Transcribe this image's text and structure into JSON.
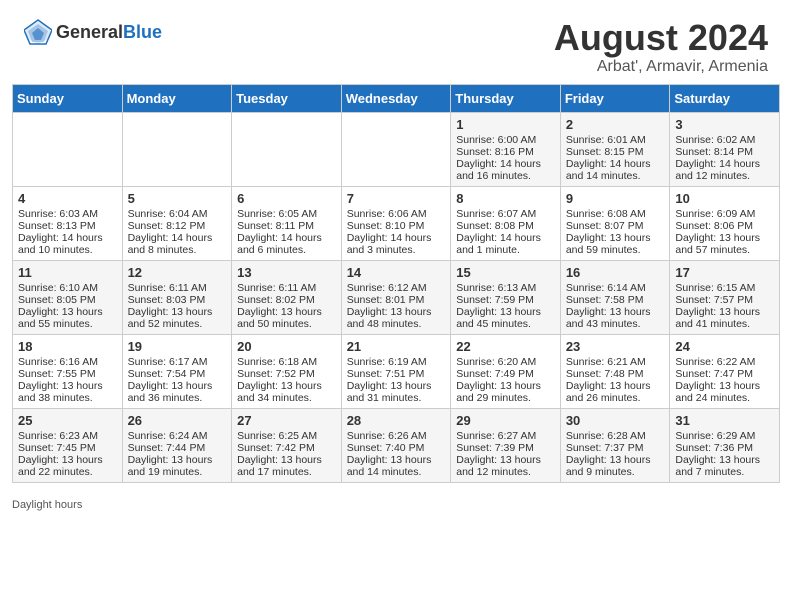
{
  "header": {
    "logo_general": "General",
    "logo_blue": "Blue",
    "title": "August 2024",
    "subtitle": "Arbat', Armavir, Armenia"
  },
  "days_of_week": [
    "Sunday",
    "Monday",
    "Tuesday",
    "Wednesday",
    "Thursday",
    "Friday",
    "Saturday"
  ],
  "weeks": [
    [
      {
        "day": "",
        "info": ""
      },
      {
        "day": "",
        "info": ""
      },
      {
        "day": "",
        "info": ""
      },
      {
        "day": "",
        "info": ""
      },
      {
        "day": "1",
        "info": "Sunrise: 6:00 AM\nSunset: 8:16 PM\nDaylight: 14 hours and 16 minutes."
      },
      {
        "day": "2",
        "info": "Sunrise: 6:01 AM\nSunset: 8:15 PM\nDaylight: 14 hours and 14 minutes."
      },
      {
        "day": "3",
        "info": "Sunrise: 6:02 AM\nSunset: 8:14 PM\nDaylight: 14 hours and 12 minutes."
      }
    ],
    [
      {
        "day": "4",
        "info": "Sunrise: 6:03 AM\nSunset: 8:13 PM\nDaylight: 14 hours and 10 minutes."
      },
      {
        "day": "5",
        "info": "Sunrise: 6:04 AM\nSunset: 8:12 PM\nDaylight: 14 hours and 8 minutes."
      },
      {
        "day": "6",
        "info": "Sunrise: 6:05 AM\nSunset: 8:11 PM\nDaylight: 14 hours and 6 minutes."
      },
      {
        "day": "7",
        "info": "Sunrise: 6:06 AM\nSunset: 8:10 PM\nDaylight: 14 hours and 3 minutes."
      },
      {
        "day": "8",
        "info": "Sunrise: 6:07 AM\nSunset: 8:08 PM\nDaylight: 14 hours and 1 minute."
      },
      {
        "day": "9",
        "info": "Sunrise: 6:08 AM\nSunset: 8:07 PM\nDaylight: 13 hours and 59 minutes."
      },
      {
        "day": "10",
        "info": "Sunrise: 6:09 AM\nSunset: 8:06 PM\nDaylight: 13 hours and 57 minutes."
      }
    ],
    [
      {
        "day": "11",
        "info": "Sunrise: 6:10 AM\nSunset: 8:05 PM\nDaylight: 13 hours and 55 minutes."
      },
      {
        "day": "12",
        "info": "Sunrise: 6:11 AM\nSunset: 8:03 PM\nDaylight: 13 hours and 52 minutes."
      },
      {
        "day": "13",
        "info": "Sunrise: 6:11 AM\nSunset: 8:02 PM\nDaylight: 13 hours and 50 minutes."
      },
      {
        "day": "14",
        "info": "Sunrise: 6:12 AM\nSunset: 8:01 PM\nDaylight: 13 hours and 48 minutes."
      },
      {
        "day": "15",
        "info": "Sunrise: 6:13 AM\nSunset: 7:59 PM\nDaylight: 13 hours and 45 minutes."
      },
      {
        "day": "16",
        "info": "Sunrise: 6:14 AM\nSunset: 7:58 PM\nDaylight: 13 hours and 43 minutes."
      },
      {
        "day": "17",
        "info": "Sunrise: 6:15 AM\nSunset: 7:57 PM\nDaylight: 13 hours and 41 minutes."
      }
    ],
    [
      {
        "day": "18",
        "info": "Sunrise: 6:16 AM\nSunset: 7:55 PM\nDaylight: 13 hours and 38 minutes."
      },
      {
        "day": "19",
        "info": "Sunrise: 6:17 AM\nSunset: 7:54 PM\nDaylight: 13 hours and 36 minutes."
      },
      {
        "day": "20",
        "info": "Sunrise: 6:18 AM\nSunset: 7:52 PM\nDaylight: 13 hours and 34 minutes."
      },
      {
        "day": "21",
        "info": "Sunrise: 6:19 AM\nSunset: 7:51 PM\nDaylight: 13 hours and 31 minutes."
      },
      {
        "day": "22",
        "info": "Sunrise: 6:20 AM\nSunset: 7:49 PM\nDaylight: 13 hours and 29 minutes."
      },
      {
        "day": "23",
        "info": "Sunrise: 6:21 AM\nSunset: 7:48 PM\nDaylight: 13 hours and 26 minutes."
      },
      {
        "day": "24",
        "info": "Sunrise: 6:22 AM\nSunset: 7:47 PM\nDaylight: 13 hours and 24 minutes."
      }
    ],
    [
      {
        "day": "25",
        "info": "Sunrise: 6:23 AM\nSunset: 7:45 PM\nDaylight: 13 hours and 22 minutes."
      },
      {
        "day": "26",
        "info": "Sunrise: 6:24 AM\nSunset: 7:44 PM\nDaylight: 13 hours and 19 minutes."
      },
      {
        "day": "27",
        "info": "Sunrise: 6:25 AM\nSunset: 7:42 PM\nDaylight: 13 hours and 17 minutes."
      },
      {
        "day": "28",
        "info": "Sunrise: 6:26 AM\nSunset: 7:40 PM\nDaylight: 13 hours and 14 minutes."
      },
      {
        "day": "29",
        "info": "Sunrise: 6:27 AM\nSunset: 7:39 PM\nDaylight: 13 hours and 12 minutes."
      },
      {
        "day": "30",
        "info": "Sunrise: 6:28 AM\nSunset: 7:37 PM\nDaylight: 13 hours and 9 minutes."
      },
      {
        "day": "31",
        "info": "Sunrise: 6:29 AM\nSunset: 7:36 PM\nDaylight: 13 hours and 7 minutes."
      }
    ]
  ],
  "footer_note": "Daylight hours"
}
